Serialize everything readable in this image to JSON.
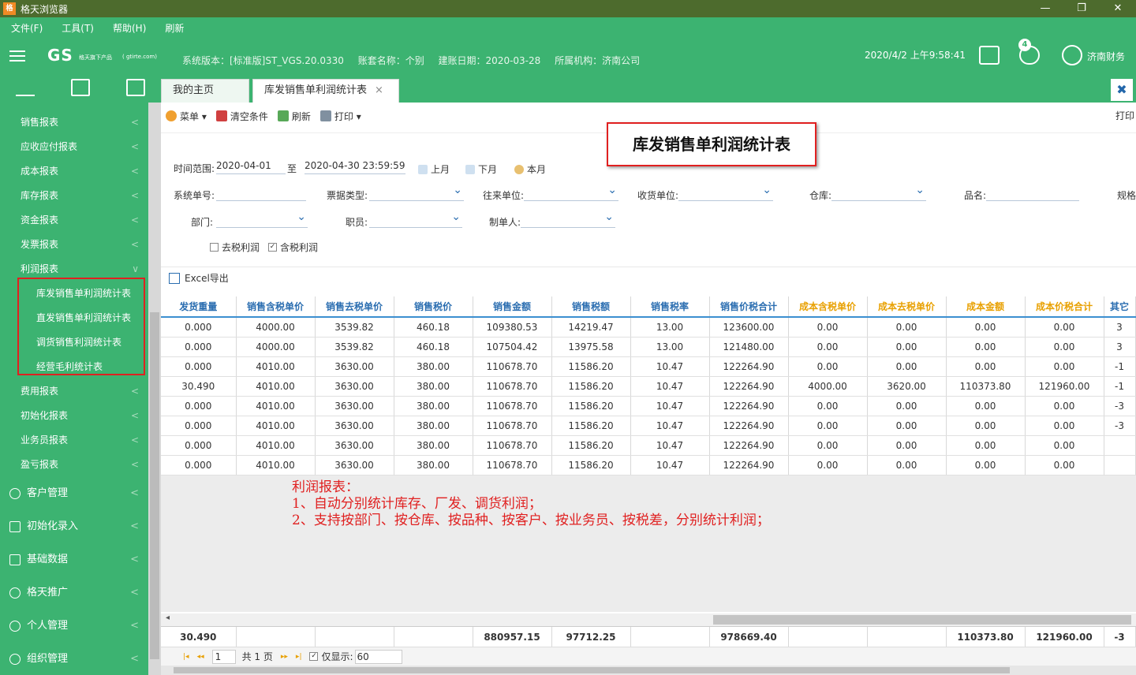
{
  "window": {
    "title": "格天浏览器",
    "logo_text": "格",
    "minimize": "—",
    "restore": "❐",
    "close": "✕"
  },
  "menubar": [
    "文件(F)",
    "工具(T)",
    "帮助(H)",
    "刷新"
  ],
  "header": {
    "logo": "GS",
    "logo_sub": "格天旗下产品",
    "logo_domain": "( gtirte.com)",
    "version": "系统版本：[标准版]ST_VGS.20.0330",
    "account": "账套名称：个别",
    "created": "建账日期：2020-03-28",
    "org": "所属机构：济南公司",
    "datetime": "2020/4/2 上午9:58:41",
    "badge": "4",
    "user": "济南财务"
  },
  "sidebar": {
    "items": [
      {
        "label": "销售报表",
        "chev": "<"
      },
      {
        "label": "应收应付报表",
        "chev": "<"
      },
      {
        "label": "成本报表",
        "chev": "<"
      },
      {
        "label": "库存报表",
        "chev": "<"
      },
      {
        "label": "资金报表",
        "chev": "<"
      },
      {
        "label": "发票报表",
        "chev": "<"
      },
      {
        "label": "利润报表",
        "chev": "∨"
      }
    ],
    "subitems": [
      "库发销售单利润统计表",
      "直发销售单利润统计表",
      "调货销售利润统计表",
      "经营毛利统计表"
    ],
    "items2": [
      {
        "label": "费用报表",
        "chev": "<"
      },
      {
        "label": "初始化报表",
        "chev": "<"
      },
      {
        "label": "业务员报表",
        "chev": "<"
      },
      {
        "label": "盈亏报表",
        "chev": "<"
      }
    ],
    "groups": [
      {
        "label": "客户管理",
        "chev": "<"
      },
      {
        "label": "初始化录入",
        "chev": "<"
      },
      {
        "label": "基础数据",
        "chev": "<"
      },
      {
        "label": "格天推广",
        "chev": "<"
      },
      {
        "label": "个人管理",
        "chev": "<"
      },
      {
        "label": "组织管理",
        "chev": "<"
      }
    ]
  },
  "tabs": [
    {
      "label": "我的主页"
    },
    {
      "label": "库发销售单利润统计表",
      "close": "×"
    }
  ],
  "tab_close_all": "✖",
  "toolbar": {
    "menu": "菜单 ▾",
    "clear": "清空条件",
    "refresh": "刷新",
    "print": "打印 ▾",
    "print_right": "打印"
  },
  "report_title": "库发销售单利润统计表",
  "filters": {
    "time_range_label": "时间范围:",
    "date_from": "2020-04-01",
    "to": "至",
    "date_to": "2020-04-30 23:59:59",
    "prev_month": "上月",
    "next_month": "下月",
    "this_month": "本月",
    "doc_no": "系统单号:",
    "bill_type": "票据类型:",
    "partner": "往来单位:",
    "receiver": "收货单位:",
    "warehouse": "仓库:",
    "product": "品名:",
    "spec": "规格",
    "dept": "部门:",
    "staff": "职员:",
    "maker": "制单人:",
    "chk_no_tax": "去税利润",
    "chk_with_tax": "含税利润",
    "chk_mark": "✓"
  },
  "excel_export": "Excel导出",
  "grid": {
    "columns": [
      "发货重量",
      "销售含税单价",
      "销售去税单价",
      "销售税价",
      "销售金额",
      "销售税额",
      "销售税率",
      "销售价税合计",
      "成本含税单价",
      "成本去税单价",
      "成本金额",
      "成本价税合计",
      "其它"
    ],
    "rows": [
      [
        "0.000",
        "4000.00",
        "3539.82",
        "460.18",
        "109380.53",
        "14219.47",
        "13.00",
        "123600.00",
        "0.00",
        "0.00",
        "0.00",
        "0.00",
        "3"
      ],
      [
        "0.000",
        "4000.00",
        "3539.82",
        "460.18",
        "107504.42",
        "13975.58",
        "13.00",
        "121480.00",
        "0.00",
        "0.00",
        "0.00",
        "0.00",
        "3"
      ],
      [
        "0.000",
        "4010.00",
        "3630.00",
        "380.00",
        "110678.70",
        "11586.20",
        "10.47",
        "122264.90",
        "0.00",
        "0.00",
        "0.00",
        "0.00",
        "-1"
      ],
      [
        "30.490",
        "4010.00",
        "3630.00",
        "380.00",
        "110678.70",
        "11586.20",
        "10.47",
        "122264.90",
        "4000.00",
        "3620.00",
        "110373.80",
        "121960.00",
        "-1"
      ],
      [
        "0.000",
        "4010.00",
        "3630.00",
        "380.00",
        "110678.70",
        "11586.20",
        "10.47",
        "122264.90",
        "0.00",
        "0.00",
        "0.00",
        "0.00",
        "-3"
      ],
      [
        "0.000",
        "4010.00",
        "3630.00",
        "380.00",
        "110678.70",
        "11586.20",
        "10.47",
        "122264.90",
        "0.00",
        "0.00",
        "0.00",
        "0.00",
        "-3"
      ],
      [
        "0.000",
        "4010.00",
        "3630.00",
        "380.00",
        "110678.70",
        "11586.20",
        "10.47",
        "122264.90",
        "0.00",
        "0.00",
        "0.00",
        "0.00",
        ""
      ],
      [
        "0.000",
        "4010.00",
        "3630.00",
        "380.00",
        "110678.70",
        "11586.20",
        "10.47",
        "122264.90",
        "0.00",
        "0.00",
        "0.00",
        "0.00",
        ""
      ]
    ],
    "totals": [
      "30.490",
      "",
      "",
      "",
      "880957.15",
      "97712.25",
      "",
      "978669.40",
      "",
      "",
      "110373.80",
      "121960.00",
      "-3"
    ]
  },
  "annotation": {
    "line1": "利润报表：",
    "line2": "1、自动分别统计库存、厂发、调货利润；",
    "line3": "2、支持按部门、按仓库、按品种、按客户、按业务员、按税差，分别统计利润；"
  },
  "pager": {
    "first": "|◂",
    "prev": "◂◂",
    "page": "1",
    "total": "共 1 页",
    "next": "▸▸",
    "last": "▸|",
    "show_only": "仅显示:",
    "count": "60",
    "chk_mark": "✓"
  },
  "hscroll_arrow": "◂"
}
